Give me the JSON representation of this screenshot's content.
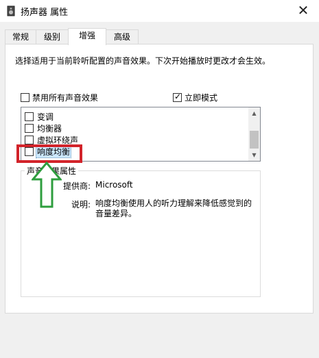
{
  "window": {
    "title": "扬声器 属性",
    "close_label": "✕",
    "title_icon": "speaker-icon"
  },
  "tabs": [
    {
      "label": "常规",
      "active": false
    },
    {
      "label": "级别",
      "active": false
    },
    {
      "label": "增强",
      "active": true
    },
    {
      "label": "高级",
      "active": false
    }
  ],
  "enhancements": {
    "description": "选择适用于当前聆听配置的声音效果。下次开始播放时更改才会生效。",
    "disable_all": {
      "label": "禁用所有声音效果",
      "checked": false
    },
    "immediate_mode": {
      "label": "立即模式",
      "checked": true
    },
    "effects": [
      {
        "label": "变调",
        "checked": false
      },
      {
        "label": "均衡器",
        "checked": false
      },
      {
        "label": "虚拟环绕声",
        "checked": false
      },
      {
        "label": "响度均衡",
        "checked": false,
        "selected": true
      }
    ]
  },
  "properties": {
    "group_title": "声音效果属性",
    "provider_label": "提供商:",
    "provider_value": "Microsoft",
    "description_label": "说明:",
    "description_value": "响度均衡使用人的听力理解来降低感觉到的音量差异。"
  },
  "annotation": {
    "highlight_color": "#d2232a",
    "arrow_color": "#2e9e3e"
  }
}
